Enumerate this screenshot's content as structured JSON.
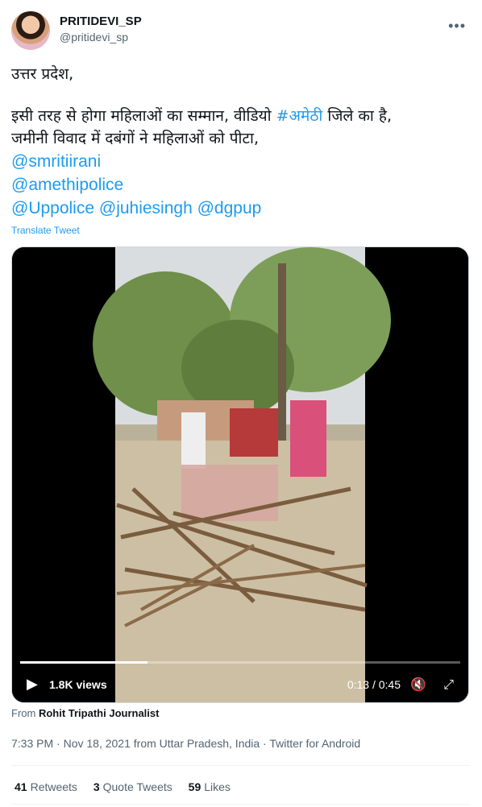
{
  "user": {
    "display_name": "PRITIDEVI_SP",
    "handle": "@pritidevi_sp",
    "more_icon": "more-icon"
  },
  "tweet": {
    "line1": "उत्तर प्रदेश,",
    "line2_before": " इसी तरह से होगा महिलाओं का सम्मान, वीडियो ",
    "hashtag": "#अमेठी",
    "line2_after": " जिले का है,",
    "line3": "जमीनी विवाद में दबंगों ने महिलाओं को पीटा,",
    "mention1": "@smritiirani",
    "mention2": "@amethipolice",
    "mention3a": "@Uppolice",
    "mention3b": "@juhiesingh",
    "mention3c": "@dgpup",
    "translate_label": "Translate Tweet"
  },
  "video": {
    "views": "1.8K views",
    "current_time": "0:13",
    "separator": " / ",
    "duration": "0:45",
    "progress": 0.289
  },
  "source": {
    "prefix": "From ",
    "name": "Rohit Tripathi Journalist"
  },
  "meta": {
    "time": "7:33 PM",
    "sep": " · ",
    "date": "Nov 18, 2021 from Uttar Pradesh, India",
    "client": "Twitter for Android"
  },
  "stats": {
    "retweets_count": "41",
    "retweets_label": "Retweets",
    "quotes_count": "3",
    "quotes_label": "Quote Tweets",
    "likes_count": "59",
    "likes_label": "Likes"
  },
  "colors": {
    "link": "#1d9bf0",
    "secondary": "#536471",
    "text": "#0f1419"
  }
}
